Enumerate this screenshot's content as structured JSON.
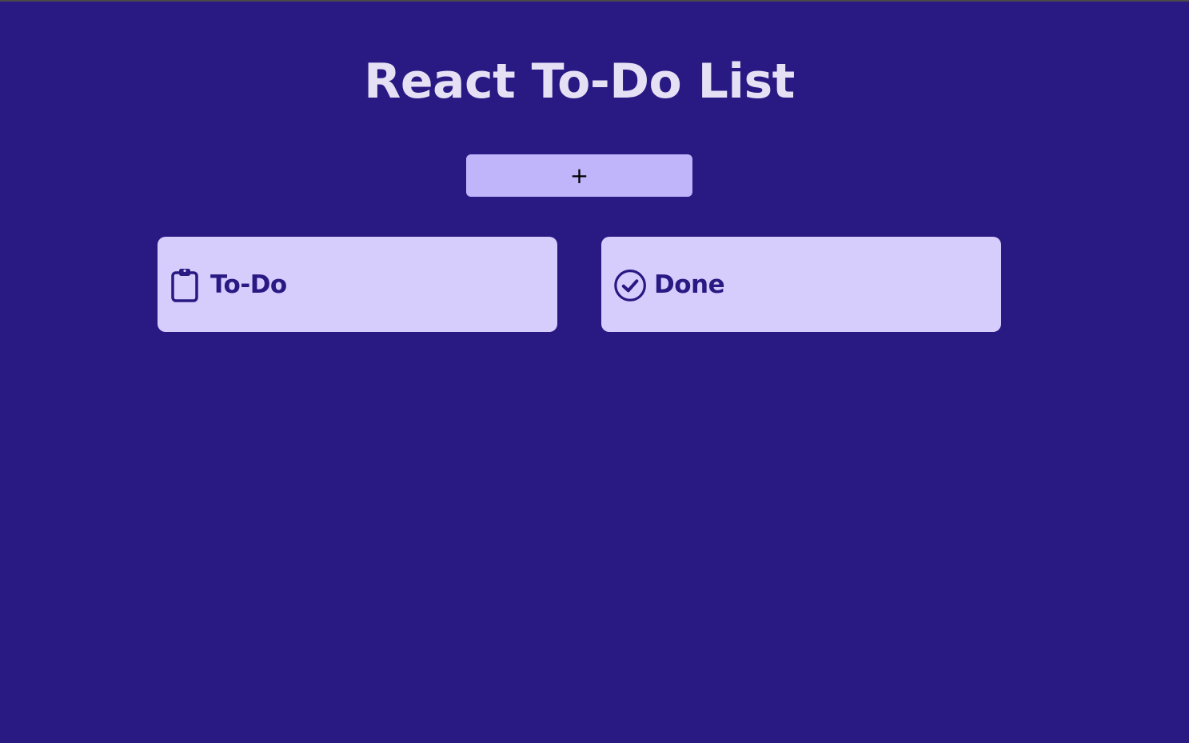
{
  "app": {
    "title": "React To-Do List"
  },
  "toolbar": {
    "add_label": "+"
  },
  "columns": [
    {
      "label": "To-Do",
      "icon": "clipboard-icon"
    },
    {
      "label": "Done",
      "icon": "check-circle-icon"
    }
  ],
  "colors": {
    "background": "#291982",
    "title_text": "#e6e0f5",
    "add_button": "#c0b4fa",
    "card": "#d7cdfd",
    "card_text": "#291982"
  }
}
